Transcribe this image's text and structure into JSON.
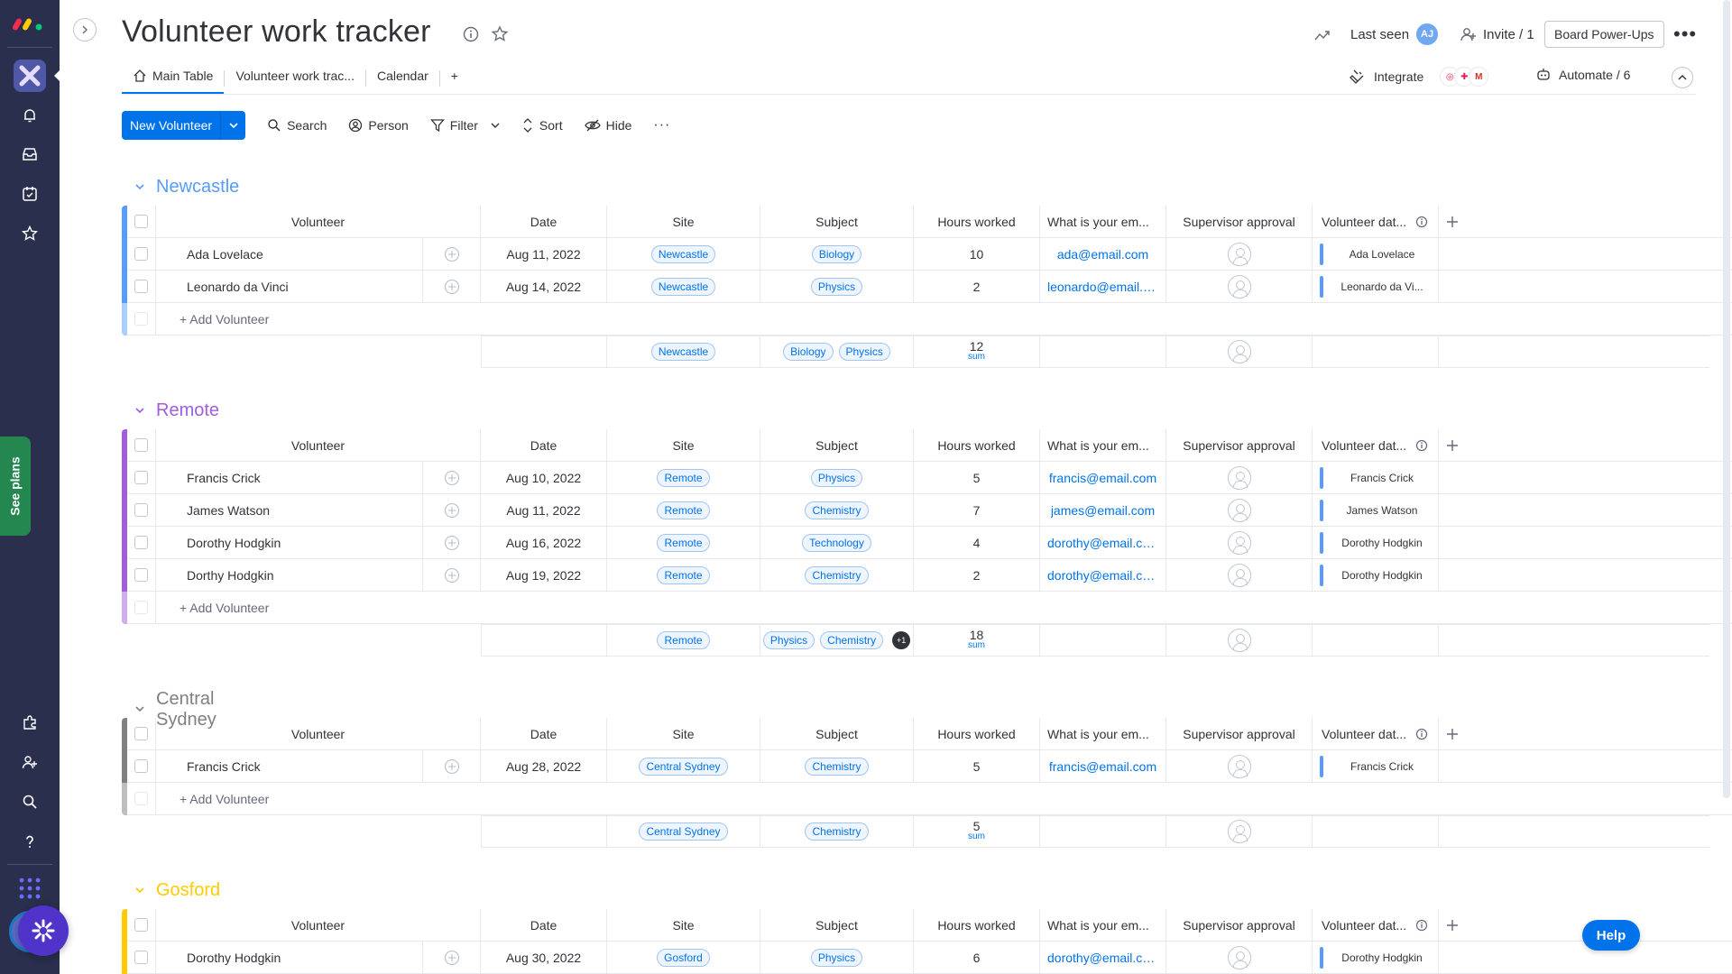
{
  "board": {
    "title": "Volunteer work tracker",
    "last_seen_label": "Last seen",
    "last_seen_initials": "AJ",
    "invite_label": "Invite / 1",
    "powerups_label": "Board Power-Ups"
  },
  "tabs": [
    {
      "label": "Main Table"
    },
    {
      "label": "Volunteer work trac..."
    },
    {
      "label": "Calendar"
    },
    {
      "label": "+"
    }
  ],
  "integrate_label": "Integrate",
  "automate_label": "Automate / 6",
  "see_plans_label": "See plans",
  "help_label": "Help",
  "toolbar": {
    "new_label": "New Volunteer",
    "search": "Search",
    "person": "Person",
    "filter": "Filter",
    "sort": "Sort",
    "hide": "Hide"
  },
  "columns": [
    "Volunteer",
    "Date",
    "Site",
    "Subject",
    "Hours worked",
    "What is your em...",
    "Supervisor approval",
    "Volunteer dat..."
  ],
  "add_label": "+ Add Volunteer",
  "sum_label": "sum",
  "colors": {
    "accent": "#0073ea",
    "newcastle": "#579bfc",
    "remote": "#a25ddc",
    "central": "#808080",
    "gosford": "#ffcb00",
    "rail": "#292f4c"
  },
  "groups": [
    {
      "name": "Newcastle",
      "rows": [
        {
          "volunteer": "Ada Lovelace",
          "date": "Aug 11, 2022",
          "site": "Newcastle",
          "subject": "Biology",
          "hours": "10",
          "email": "ada@email.com",
          "vd": "Ada Lovelace"
        },
        {
          "volunteer": "Leonardo da Vinci",
          "date": "Aug 14, 2022",
          "site": "Newcastle",
          "subject": "Physics",
          "hours": "2",
          "email": "leonardo@email.c...",
          "vd": "Leonardo da Vi..."
        }
      ],
      "summary": {
        "site": "Newcastle",
        "subjects": [
          "Biology",
          "Physics"
        ],
        "extra": "",
        "hours": "12"
      }
    },
    {
      "name": "Remote",
      "rows": [
        {
          "volunteer": "Francis Crick",
          "date": "Aug 10, 2022",
          "site": "Remote",
          "subject": "Physics",
          "hours": "5",
          "email": "francis@email.com",
          "vd": "Francis Crick"
        },
        {
          "volunteer": "James Watson",
          "date": "Aug 11, 2022",
          "site": "Remote",
          "subject": "Chemistry",
          "hours": "7",
          "email": "james@email.com",
          "vd": "James Watson"
        },
        {
          "volunteer": "Dorothy Hodgkin",
          "date": "Aug 16, 2022",
          "site": "Remote",
          "subject": "Technology",
          "hours": "4",
          "email": "dorothy@email.co...",
          "vd": "Dorothy Hodgkin"
        },
        {
          "volunteer": "Dorthy Hodgkin",
          "date": "Aug 19, 2022",
          "site": "Remote",
          "subject": "Chemistry",
          "hours": "2",
          "email": "dorothy@email.co...",
          "vd": "Dorothy Hodgkin"
        }
      ],
      "summary": {
        "site": "Remote",
        "subjects": [
          "Physics",
          "Chemistry"
        ],
        "extra": "+1",
        "hours": "18"
      }
    },
    {
      "name": "Central Sydney",
      "rows": [
        {
          "volunteer": "Francis Crick",
          "date": "Aug 28, 2022",
          "site": "Central Sydney",
          "subject": "Chemistry",
          "hours": "5",
          "email": "francis@email.com",
          "vd": "Francis Crick"
        }
      ],
      "summary": {
        "site": "Central Sydney",
        "subjects": [
          "Chemistry"
        ],
        "extra": "",
        "hours": "5"
      }
    },
    {
      "name": "Gosford",
      "rows": [
        {
          "volunteer": "Dorothy Hodgkin",
          "date": "Aug 30, 2022",
          "site": "Gosford",
          "subject": "Physics",
          "hours": "6",
          "email": "dorothy@email.co...",
          "vd": "Dorothy Hodgkin"
        }
      ],
      "summary": null
    }
  ]
}
